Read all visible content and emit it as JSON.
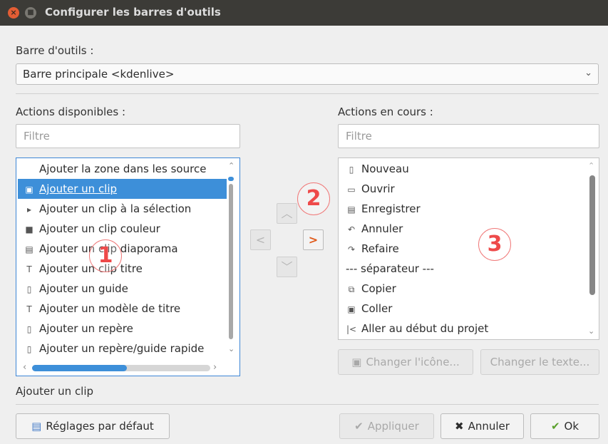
{
  "window": {
    "title": "Configurer les barres d'outils",
    "close_glyph": "×",
    "min_glyph": "■"
  },
  "toolbar_label": "Barre d'outils :",
  "toolbar_combo": {
    "value": "Barre principale <kdenlive>"
  },
  "available": {
    "label": "Actions disponibles :",
    "filter_placeholder": "Filtre",
    "items": [
      {
        "icon": "",
        "label": "Ajouter la zone dans les source"
      },
      {
        "icon": "▣",
        "label": "Ajouter un clip"
      },
      {
        "icon": "▸",
        "label": "Ajouter un clip à la sélection"
      },
      {
        "icon": "■",
        "label": "Ajouter un clip couleur"
      },
      {
        "icon": "▤",
        "label": "Ajouter un clip diaporama"
      },
      {
        "icon": "T",
        "label": "Ajouter un clip titre"
      },
      {
        "icon": "▯",
        "label": "Ajouter un guide"
      },
      {
        "icon": "T",
        "label": "Ajouter un modèle de titre"
      },
      {
        "icon": "▯",
        "label": "Ajouter un repère"
      },
      {
        "icon": "▯",
        "label": "Ajouter un repère/guide rapide"
      }
    ]
  },
  "current": {
    "label": "Actions en cours :",
    "filter_placeholder": "Filtre",
    "items": [
      {
        "icon": "▯",
        "label": "Nouveau"
      },
      {
        "icon": "▭",
        "label": "Ouvrir"
      },
      {
        "icon": "▤",
        "label": "Enregistrer"
      },
      {
        "icon": "↶",
        "label": "Annuler"
      },
      {
        "icon": "↷",
        "label": "Refaire"
      },
      {
        "icon": "",
        "label": "--- séparateur ---"
      },
      {
        "icon": "⧉",
        "label": "Copier"
      },
      {
        "icon": "▣",
        "label": "Coller"
      },
      {
        "icon": "|<",
        "label": "Aller au début du projet"
      }
    ]
  },
  "move_buttons": {
    "up": "︿",
    "left": "<",
    "right": ">",
    "down": "﹀"
  },
  "badges": [
    "1",
    "2",
    "3"
  ],
  "change_icon_button": "Changer l'icône...",
  "change_text_button": "Changer le texte...",
  "status_text": "Ajouter un clip",
  "defaults_button": "Réglages par défaut",
  "apply_button": "Appliquer",
  "cancel_button": "Annuler",
  "ok_button": "Ok",
  "colors": {
    "accent": "#3d8fd9",
    "arrow_active": "#e05a1a",
    "badge": "#ee4a4a"
  }
}
